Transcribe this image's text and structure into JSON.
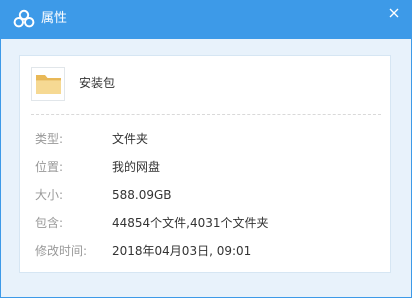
{
  "window": {
    "title": "属性",
    "icons": {
      "logo": "baidu-netdisk-logo-icon",
      "close": "close-icon",
      "folder": "folder-icon"
    },
    "colors": {
      "titlebar": "#3d9ae8",
      "background": "#e8f2fb",
      "folder": "#f3cd7a"
    }
  },
  "item": {
    "name": "安装包"
  },
  "properties": [
    {
      "label": "类型:",
      "value": "文件夹"
    },
    {
      "label": "位置:",
      "value": "我的网盘"
    },
    {
      "label": "大小:",
      "value": "588.09GB"
    },
    {
      "label": "包含:",
      "value": "44854个文件,4031个文件夹"
    },
    {
      "label": "修改时间:",
      "value": "2018年04月03日, 09:01"
    }
  ]
}
